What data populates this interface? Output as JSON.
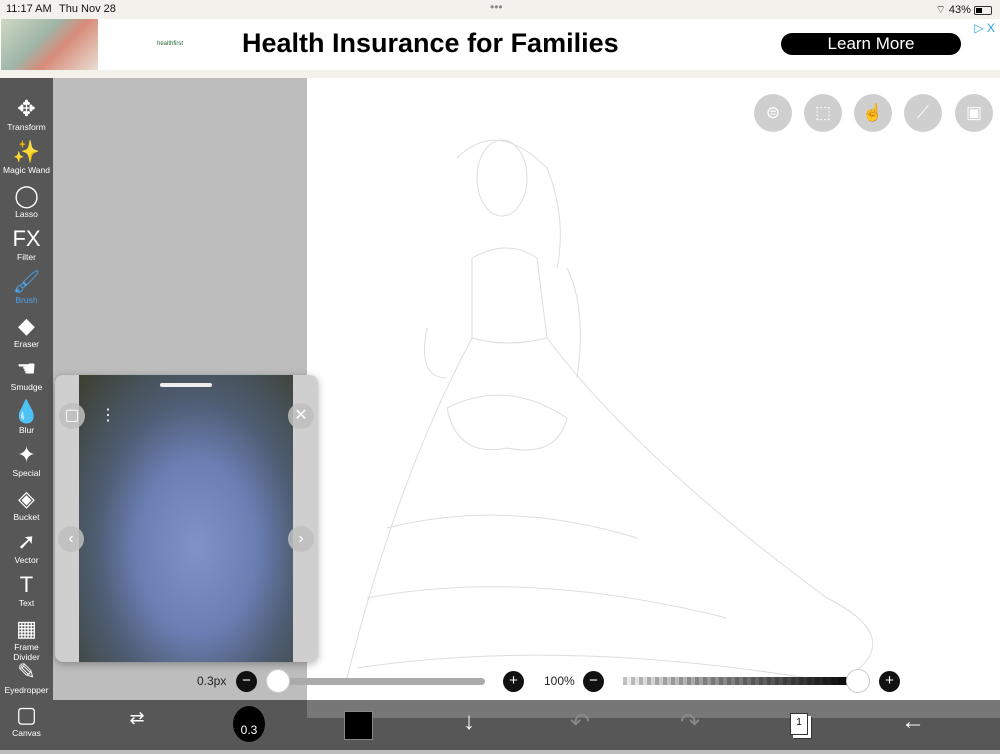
{
  "status": {
    "time": "11:17 AM",
    "date": "Thu Nov 28",
    "battery": "43%"
  },
  "ad": {
    "brand": "healthfirst",
    "headline": "Health Insurance for Families",
    "cta": "Learn More",
    "adchoices": "▷ X"
  },
  "tools": [
    {
      "label": "Transform",
      "icon": "✥"
    },
    {
      "label": "Magic Wand",
      "icon": "✨"
    },
    {
      "label": "Lasso",
      "icon": "◯"
    },
    {
      "label": "Filter",
      "icon": "FX"
    },
    {
      "label": "Brush",
      "icon": "🖌"
    },
    {
      "label": "Eraser",
      "icon": "◆"
    },
    {
      "label": "Smudge",
      "icon": "☚"
    },
    {
      "label": "Blur",
      "icon": "💧"
    },
    {
      "label": "Special",
      "icon": "✦"
    },
    {
      "label": "Bucket",
      "icon": "◈"
    },
    {
      "label": "Vector",
      "icon": "➚"
    },
    {
      "label": "Text",
      "icon": "T"
    },
    {
      "label": "Frame Divider",
      "icon": "▦"
    },
    {
      "label": "Eyedropper",
      "icon": "✎"
    },
    {
      "label": "Canvas",
      "icon": "▢"
    }
  ],
  "active_tool": "Brush",
  "sliders": {
    "size_label": "0.3px",
    "size_fraction": 0,
    "opacity_label": "100%",
    "opacity_fraction": 1
  },
  "bottom": {
    "brush_size": "0.3",
    "layer_count": "1",
    "color": "#000000"
  }
}
